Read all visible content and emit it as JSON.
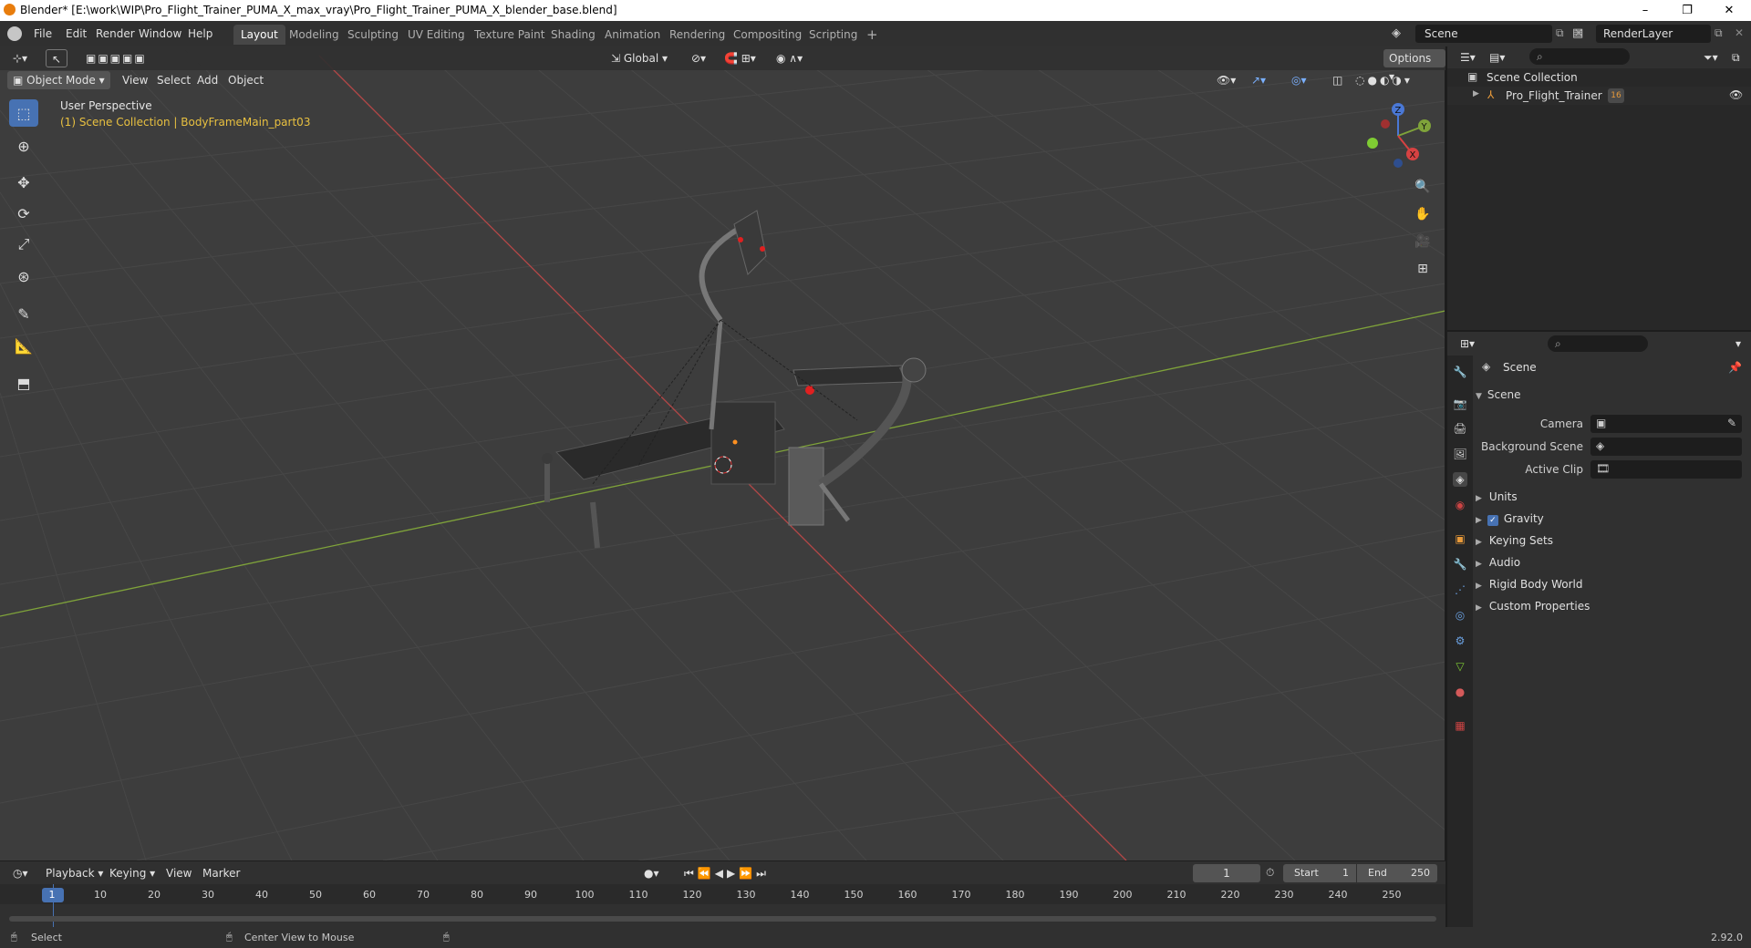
{
  "window": {
    "title": "Blender* [E:\\work\\WIP\\Pro_Flight_Trainer_PUMA_X_max_vray\\Pro_Flight_Trainer_PUMA_X_blender_base.blend]",
    "minimize": "–",
    "maximize": "❐",
    "close": "✕"
  },
  "menu": [
    "File",
    "Edit",
    "Render",
    "Window",
    "Help"
  ],
  "workspaces": [
    "Layout",
    "Modeling",
    "Sculpting",
    "UV Editing",
    "Texture Paint",
    "Shading",
    "Animation",
    "Rendering",
    "Compositing",
    "Scripting"
  ],
  "workspace_add": "+",
  "scene_field": "Scene",
  "renderlayer_field": "RenderLayer",
  "viewport": {
    "mode": "Object Mode",
    "menus": [
      "View",
      "Select",
      "Add",
      "Object"
    ],
    "transform_orientation": "Global",
    "options": "Options",
    "overlay_title": "User Perspective",
    "overlay_collection": "(1) Scene Collection | BodyFrameMain_part03",
    "gizmo": {
      "x": "X",
      "y": "Y",
      "z": "Z"
    },
    "colors": {
      "bg": "#3d3d3d",
      "grid": "#474747",
      "x_axis": "#b34747",
      "y_axis": "#7fa33a",
      "active": "#4772b3"
    }
  },
  "toolbar_icons": [
    "select-box-icon",
    "cursor-icon",
    "move-icon",
    "rotate-icon",
    "scale-icon",
    "transform-icon",
    "annotate-icon",
    "measure-icon",
    "add-cube-icon"
  ],
  "nav_icons": [
    "zoom-icon",
    "hand-pan-icon",
    "camera-view-icon",
    "grid-view-icon"
  ],
  "outliner": {
    "root": "Scene Collection",
    "items": [
      {
        "label": "Pro_Flight_Trainer",
        "badge": "16"
      }
    ]
  },
  "properties": {
    "context": "Scene",
    "panel": "Scene",
    "fields": [
      {
        "label": "Camera",
        "value": ""
      },
      {
        "label": "Background Scene",
        "value": ""
      },
      {
        "label": "Active Clip",
        "value": ""
      }
    ],
    "subpanels": [
      {
        "label": "Units",
        "checkbox": false
      },
      {
        "label": "Gravity",
        "checkbox": true
      },
      {
        "label": "Keying Sets",
        "checkbox": false
      },
      {
        "label": "Audio",
        "checkbox": false
      },
      {
        "label": "Rigid Body World",
        "checkbox": false
      },
      {
        "label": "Custom Properties",
        "checkbox": false
      }
    ]
  },
  "timeline": {
    "menus": [
      "Playback",
      "Keying",
      "View",
      "Marker"
    ],
    "current_frame": "1",
    "start_label": "Start",
    "start": "1",
    "end_label": "End",
    "end": "250",
    "ticks": [
      "1",
      "10",
      "20",
      "30",
      "40",
      "50",
      "60",
      "70",
      "80",
      "90",
      "100",
      "110",
      "120",
      "130",
      "140",
      "150",
      "160",
      "170",
      "180",
      "190",
      "200",
      "210",
      "220",
      "230",
      "240",
      "250"
    ]
  },
  "status": {
    "left": "Select",
    "middle": "Center View to Mouse",
    "version": "2.92.0"
  }
}
